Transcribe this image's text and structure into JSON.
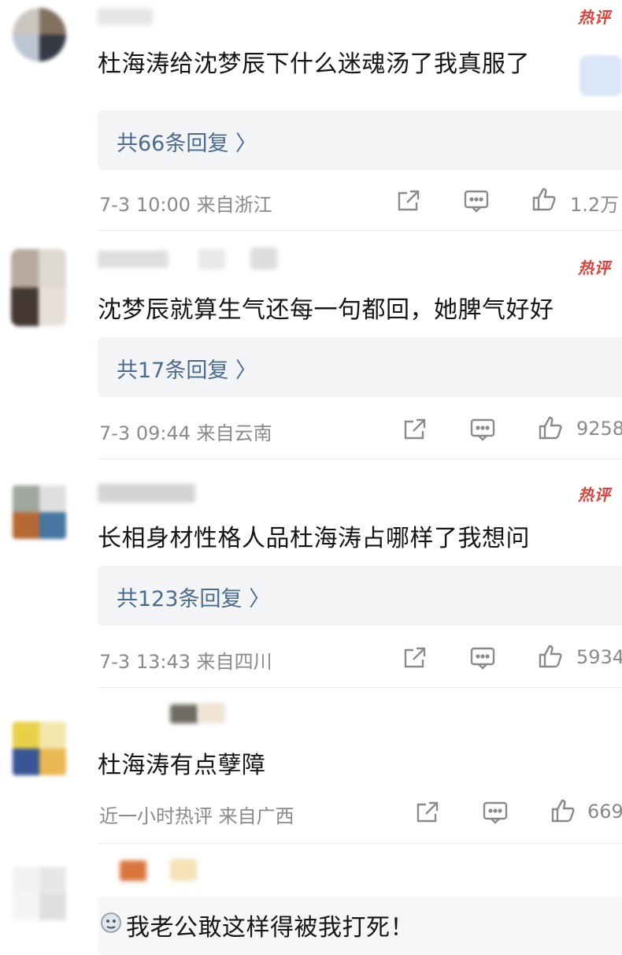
{
  "comments": [
    {
      "hot_label": "热评",
      "text": "杜海涛给沈梦辰下什么迷魂汤了我真服了",
      "reply_label": "共66条回复 〉",
      "meta": "7-3 10:00  来自浙江",
      "likes": "1.2万"
    },
    {
      "hot_label": "热评",
      "text": "沈梦辰就算生气还每一句都回，她脾气好好",
      "reply_label": "共17条回复 〉",
      "meta": "7-3 09:44  来自云南",
      "likes": "9258"
    },
    {
      "hot_label": "热评",
      "text": "长相身材性格人品杜海涛占哪样了我想问",
      "reply_label": "共123条回复 〉",
      "meta": "7-3 13:43  来自四川",
      "likes": "5934"
    },
    {
      "text": "杜海涛有点孽障",
      "meta": "近一小时热评  来自广西",
      "likes": "669"
    },
    {
      "text": "我老公敢这样得被我打死！"
    }
  ],
  "colors": {
    "hot": "#e0403a",
    "reply_link": "#4a6b8f",
    "reply_bg": "#f3f4f6",
    "meta": "#8a8a8a"
  },
  "icons": [
    "share-icon",
    "comment-icon",
    "like-icon",
    "emoji-icon"
  ]
}
